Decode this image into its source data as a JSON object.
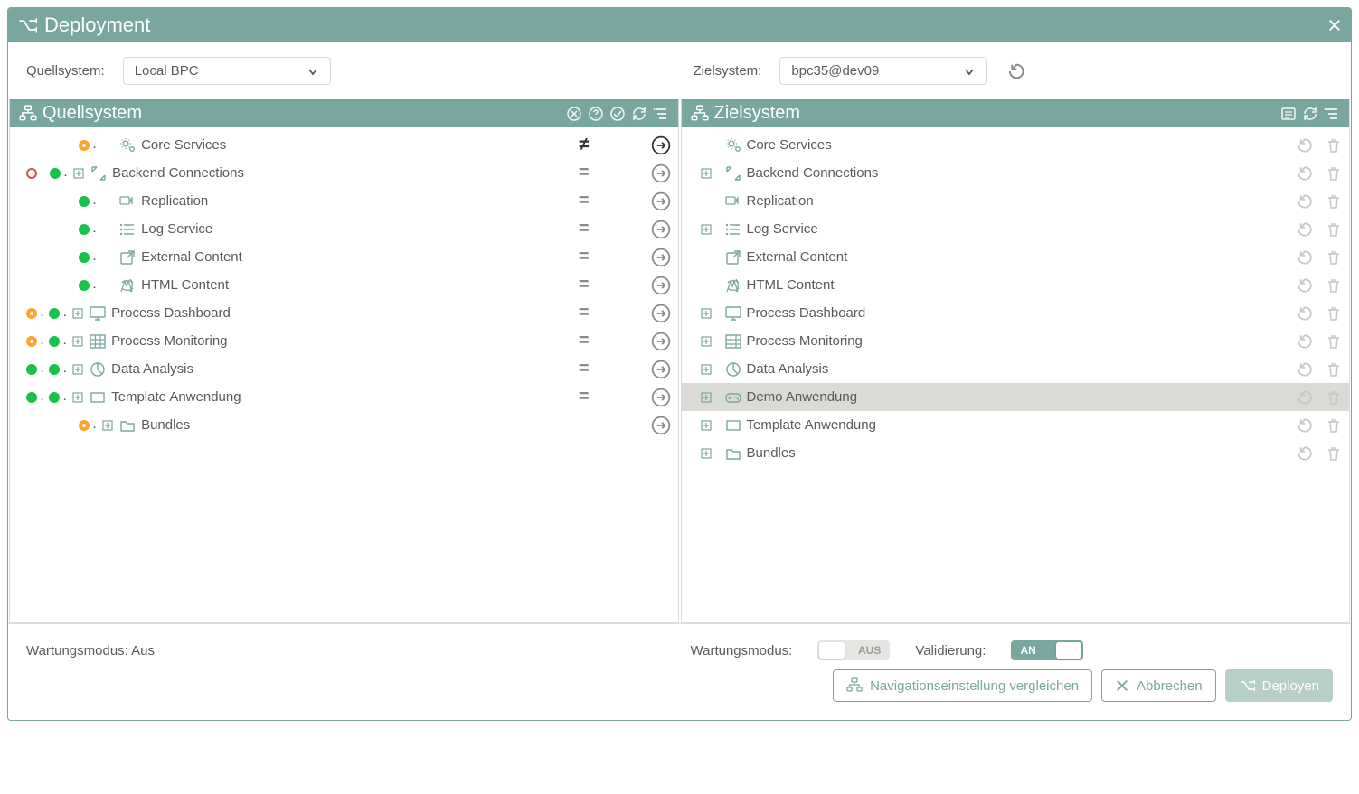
{
  "title": "Deployment",
  "source": {
    "label": "Quellsystem:",
    "value": "Local BPC",
    "panel_title": "Quellsystem",
    "items": [
      {
        "marks": [
          "orange"
        ],
        "expand": false,
        "icon": "gears",
        "label": "Core Services",
        "right": "noteq",
        "arrow": "active",
        "indent": 2
      },
      {
        "marks": [
          "red-hole",
          "green"
        ],
        "expand": true,
        "icon": "expand-arrows",
        "label": "Backend Connections",
        "right": "eq",
        "arrow": "muted",
        "indent": 0
      },
      {
        "marks": [
          "green"
        ],
        "expand": false,
        "icon": "replication",
        "label": "Replication",
        "right": "eq",
        "arrow": "muted",
        "indent": 2
      },
      {
        "marks": [
          "green"
        ],
        "expand": false,
        "icon": "list",
        "label": "Log Service",
        "right": "eq",
        "arrow": "muted",
        "indent": 2
      },
      {
        "marks": [
          "green"
        ],
        "expand": false,
        "icon": "external",
        "label": "External Content",
        "right": "eq",
        "arrow": "muted",
        "indent": 2
      },
      {
        "marks": [
          "green"
        ],
        "expand": false,
        "icon": "html",
        "label": "HTML Content",
        "right": "eq",
        "arrow": "muted",
        "indent": 2
      },
      {
        "marks": [
          "orange",
          "green"
        ],
        "expand": true,
        "icon": "monitor",
        "label": "Process Dashboard",
        "right": "eq",
        "arrow": "muted",
        "indent": 0
      },
      {
        "marks": [
          "orange",
          "green"
        ],
        "expand": true,
        "icon": "grid",
        "label": "Process Monitoring",
        "right": "eq",
        "arrow": "muted",
        "indent": 0
      },
      {
        "marks": [
          "green",
          "green"
        ],
        "expand": true,
        "icon": "pie",
        "label": "Data Analysis",
        "right": "eq",
        "arrow": "muted",
        "indent": 0
      },
      {
        "marks": [
          "green",
          "green"
        ],
        "expand": true,
        "icon": "rect",
        "label": "Template Anwendung",
        "right": "eq",
        "arrow": "muted",
        "indent": 0
      },
      {
        "marks": [
          "orange"
        ],
        "expand": true,
        "icon": "folder",
        "label": "Bundles",
        "right": "",
        "arrow": "muted",
        "indent": 2
      }
    ]
  },
  "target": {
    "label": "Zielsystem:",
    "value": "bpc35@dev09",
    "panel_title": "Zielsystem",
    "items": [
      {
        "expand": false,
        "icon": "gears",
        "label": "Core Services",
        "highlight": false
      },
      {
        "expand": true,
        "icon": "expand-arrows",
        "label": "Backend Connections",
        "highlight": false
      },
      {
        "expand": false,
        "icon": "replication",
        "label": "Replication",
        "highlight": false
      },
      {
        "expand": true,
        "icon": "list",
        "label": "Log Service",
        "highlight": false
      },
      {
        "expand": false,
        "icon": "external",
        "label": "External Content",
        "highlight": false
      },
      {
        "expand": false,
        "icon": "html",
        "label": "HTML Content",
        "highlight": false
      },
      {
        "expand": true,
        "icon": "monitor",
        "label": "Process Dashboard",
        "highlight": false
      },
      {
        "expand": true,
        "icon": "grid",
        "label": "Process Monitoring",
        "highlight": false
      },
      {
        "expand": true,
        "icon": "pie",
        "label": "Data Analysis",
        "highlight": false
      },
      {
        "expand": true,
        "icon": "gamepad",
        "label": "Demo Anwendung",
        "highlight": true
      },
      {
        "expand": true,
        "icon": "rect",
        "label": "Template Anwendung",
        "highlight": false
      },
      {
        "expand": true,
        "icon": "folder",
        "label": "Bundles",
        "highlight": false
      }
    ]
  },
  "footer": {
    "source_status": "Wartungsmodus: Aus",
    "target_maint_label": "Wartungsmodus:",
    "target_maint_value": "AUS",
    "validation_label": "Validierung:",
    "validation_value": "AN",
    "buttons": {
      "compare": "Navigationseinstellung vergleichen",
      "cancel": "Abbrechen",
      "deploy": "Deployen"
    }
  }
}
